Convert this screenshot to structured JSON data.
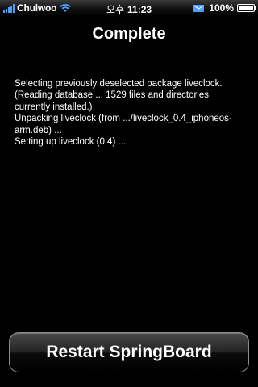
{
  "status_bar": {
    "carrier": "Chulwoo",
    "ampm": "오후",
    "time": "11:23",
    "battery": "100%",
    "battery_level": 1.0,
    "signal_bars": 5,
    "accent_color": "#4fa0ff",
    "icons": [
      "signal-icon",
      "wifi-icon",
      "mail-icon",
      "battery-icon"
    ]
  },
  "header": {
    "title": "Complete"
  },
  "log": {
    "lines": [
      "Selecting previously deselected package liveclock.",
      "(Reading database ... 1529 files and directories",
      "currently installed.)",
      "Unpacking liveclock (from .../liveclock_0.4_iphoneos-",
      "arm.deb) ...",
      "Setting up liveclock (0.4) ..."
    ]
  },
  "actions": {
    "restart_label": "Restart SpringBoard"
  }
}
